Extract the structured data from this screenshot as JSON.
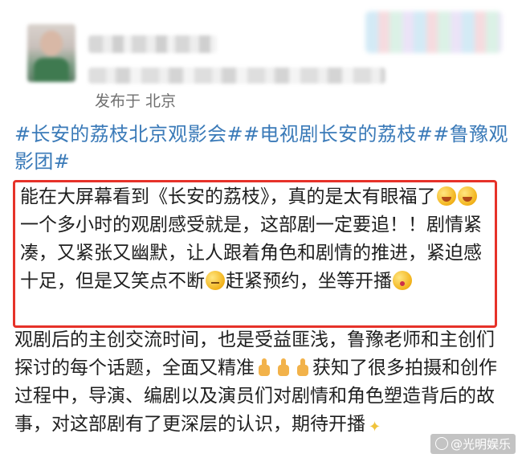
{
  "post": {
    "location": "发布于 北京",
    "hashtags": "#长安的荔枝北京观影会##电视剧长安的荔枝##鲁豫观影团#",
    "highlight": {
      "seg1": "能在大屏幕看到《长安的荔枝》，真的是太有眼福了",
      "seg2": "一个多小时的观剧感受就是，这部剧一定要追！！剧情紧凑，又紧张又幽默，让人跟着角色和剧情的推进，紧迫感十足，但是又笑点不断",
      "seg3": "赶紧预约，坐等开播"
    },
    "body": {
      "seg1": "观剧后的主创交流时间，也是受益匪浅，鲁豫老师和主创们探讨的每个话题，全面又精准",
      "seg2": "获知了很多拍摄和创作过程中，导演、编剧以及演员们对剧情和角色塑造背后的故事，对这部剧有了更深层的认识，期待开播"
    },
    "icons": {
      "emoji_laugh": "grinning-squinting-face",
      "emoji_think": "thinking-face",
      "emoji_kiss": "face-blowing-kiss",
      "thumbs": "thumbs-up",
      "sparkle": "sparkles"
    }
  },
  "watermark": "@光明娱乐",
  "colors": {
    "hashtag": "#3a7ab8",
    "highlight_border": "#e63229",
    "location": "#6f6f6f",
    "text": "#1f1f1f"
  }
}
